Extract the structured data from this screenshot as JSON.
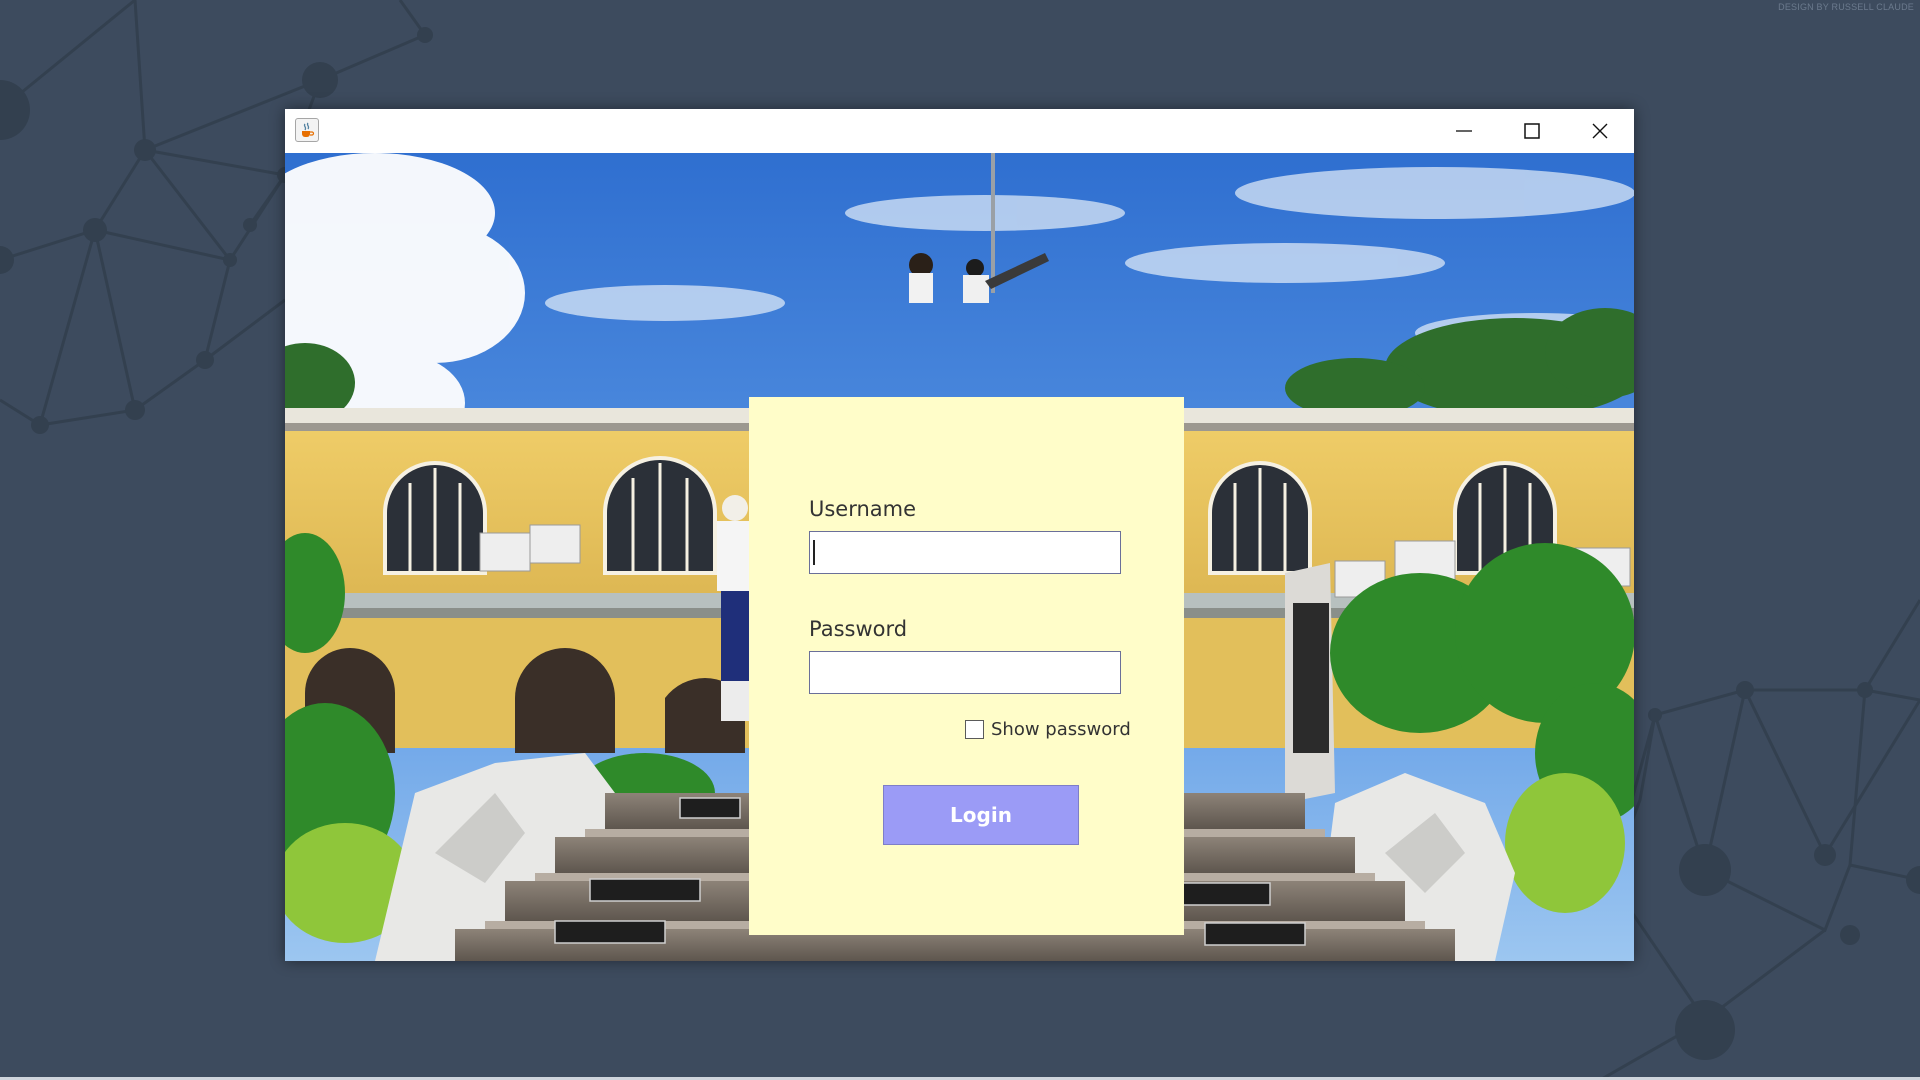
{
  "desktop": {
    "credit": "DESIGN BY RUSSELL CLAUDE"
  },
  "window": {
    "app_icon": "java-cup-icon",
    "controls": {
      "minimize": "minimize-icon",
      "maximize": "maximize-icon",
      "close": "close-icon"
    }
  },
  "login": {
    "username_label": "Username",
    "username_value": "",
    "password_label": "Password",
    "password_value": "",
    "show_password_label": "Show password",
    "show_password_checked": false,
    "login_button": "Login"
  },
  "colors": {
    "desktop_bg": "#3d4b5e",
    "panel_bg": "#fffdc9",
    "login_button_bg": "#9b9bf6"
  }
}
